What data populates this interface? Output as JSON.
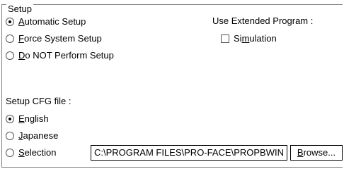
{
  "setup_group": {
    "title": "Setup",
    "options": [
      {
        "before": "",
        "accel": "A",
        "after": "utomatic Setup",
        "checked": true
      },
      {
        "before": "",
        "accel": "F",
        "after": "orce System Setup",
        "checked": false
      },
      {
        "before": "",
        "accel": "D",
        "after": "o NOT Perform Setup",
        "checked": false
      }
    ]
  },
  "extended": {
    "label": "Use Extended Program :",
    "simulation": {
      "before": "Si",
      "accel": "m",
      "after": "ulation",
      "checked": false
    }
  },
  "cfg": {
    "label": "Setup CFG file :",
    "options": [
      {
        "before": "",
        "accel": "E",
        "after": "nglish",
        "checked": true
      },
      {
        "before": "",
        "accel": "J",
        "after": "apanese",
        "checked": false
      },
      {
        "before": "",
        "accel": "S",
        "after": "election",
        "checked": false
      }
    ],
    "path_value": "C:\\PROGRAM FILES\\PRO-FACE\\PROPBWIN",
    "browse": {
      "before": "",
      "accel": "B",
      "after": "rowse..."
    }
  }
}
